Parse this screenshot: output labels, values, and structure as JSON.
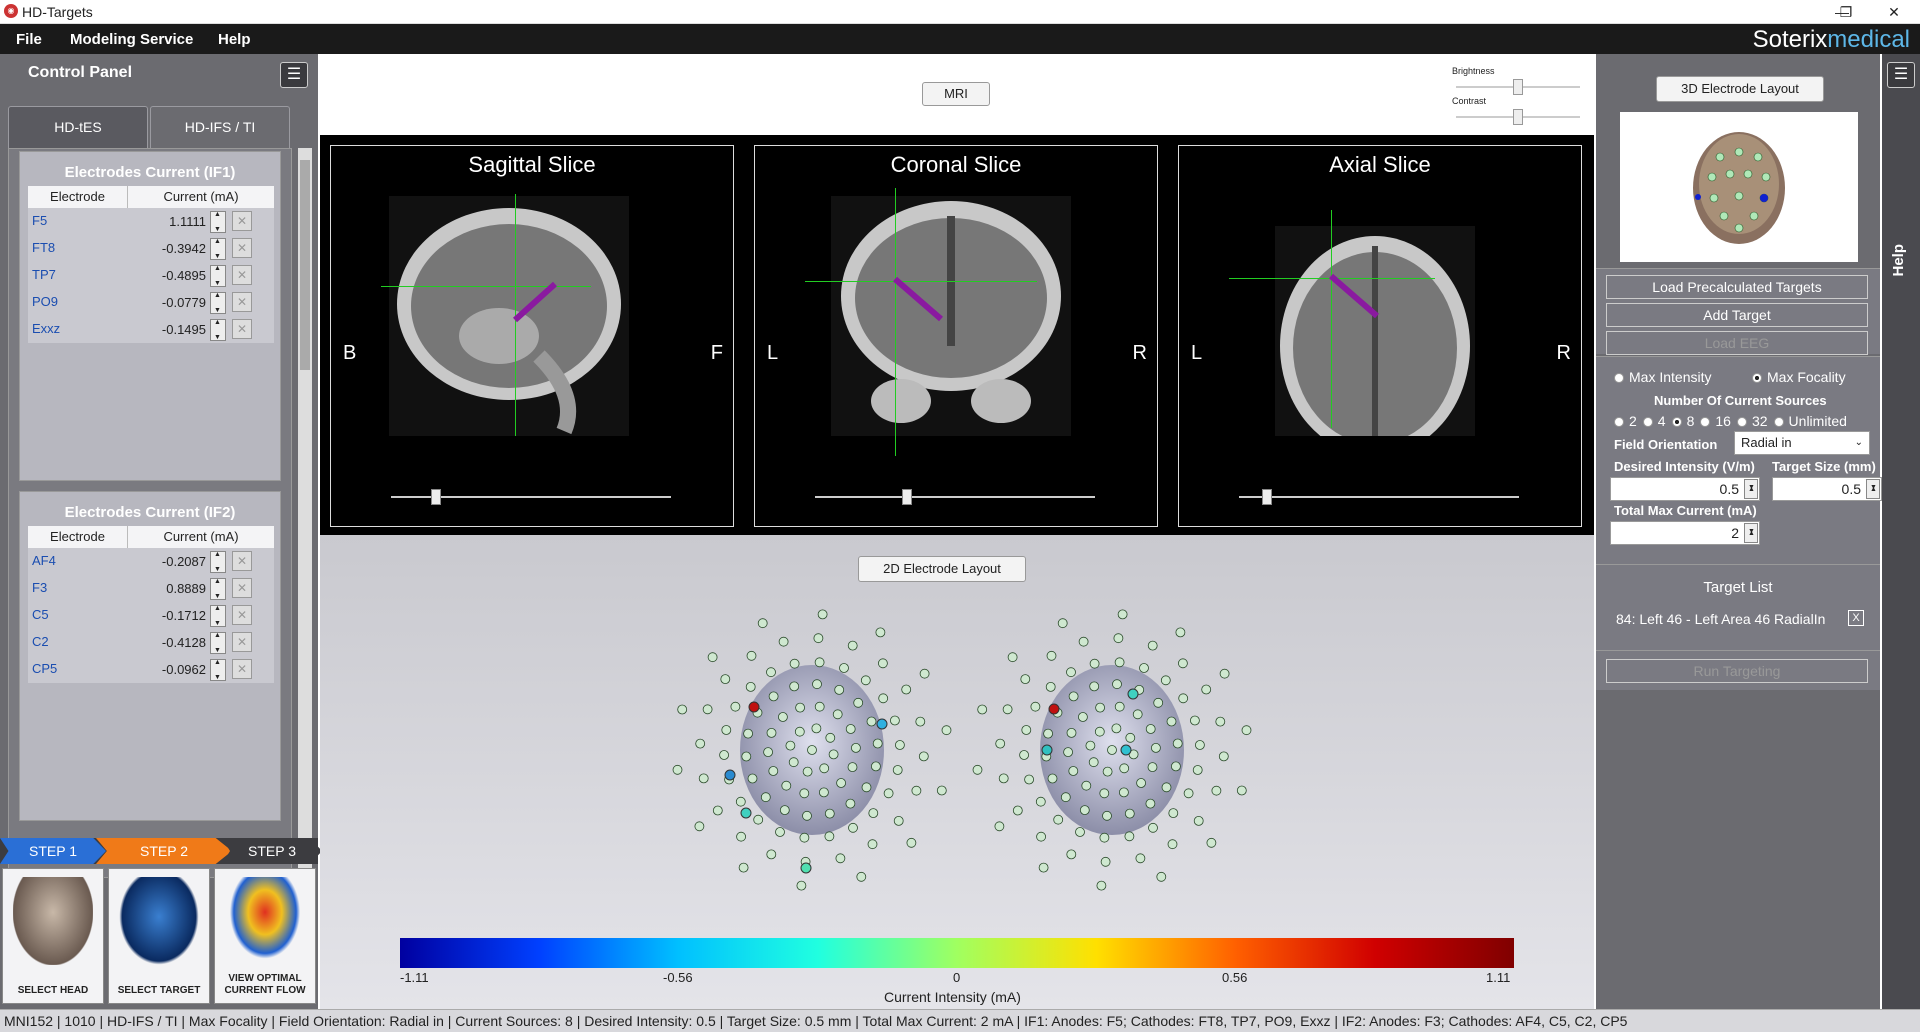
{
  "window": {
    "title": "HD-Targets",
    "minimize": "—",
    "restore": "❐",
    "close": "✕"
  },
  "menu": {
    "file": "File",
    "modeling": "Modeling Service",
    "help": "Help"
  },
  "brand": {
    "part1": "Soterix",
    "part2": "medical"
  },
  "control_panel": {
    "title": "Control Panel",
    "tabs": [
      "HD-tES",
      "HD-IFS / TI"
    ],
    "if1": {
      "title": "Electrodes Current (IF1)",
      "col_electrode": "Electrode",
      "col_current": "Current (mA)",
      "rows": [
        {
          "name": "F5",
          "value": "1.1111"
        },
        {
          "name": "FT8",
          "value": "-0.3942"
        },
        {
          "name": "TP7",
          "value": "-0.4895"
        },
        {
          "name": "PO9",
          "value": "-0.0779"
        },
        {
          "name": "Exxz",
          "value": "-0.1495"
        }
      ]
    },
    "if2": {
      "title": "Electrodes Current (IF2)",
      "col_electrode": "Electrode",
      "col_current": "Current (mA)",
      "rows": [
        {
          "name": "AF4",
          "value": "-0.2087"
        },
        {
          "name": "F3",
          "value": "0.8889"
        },
        {
          "name": "C5",
          "value": "-0.1712"
        },
        {
          "name": "C2",
          "value": "-0.4128"
        },
        {
          "name": "CP5",
          "value": "-0.0962"
        }
      ]
    },
    "steps": [
      "STEP 1",
      "STEP 2",
      "STEP 3"
    ],
    "step_cards": [
      "SELECT HEAD",
      "SELECT TARGET",
      "VIEW OPTIMAL CURRENT FLOW"
    ]
  },
  "viewer": {
    "mri_button": "MRI",
    "brightness": "Brightness",
    "contrast": "Contrast",
    "brightness_level": 0.5,
    "contrast_level": 0.5,
    "slices": [
      {
        "title": "Sagittal Slice",
        "left": "B",
        "right": "F",
        "slider": 0.16
      },
      {
        "title": "Coronal Slice",
        "left": "L",
        "right": "R",
        "slider": 0.33
      },
      {
        "title": "Axial Slice",
        "left": "L",
        "right": "R",
        "slider": 0.1
      }
    ],
    "layout_2d_button": "2D Electrode Layout",
    "colorbar": {
      "ticks": [
        "-1.11",
        "-0.56",
        "0",
        "0.56",
        "1.11"
      ],
      "label": "Current Intensity (mA)"
    }
  },
  "right_panel": {
    "layout_3d_button": "3D Electrode Layout",
    "load_targets": "Load Precalculated Targets",
    "add_target": "Add Target",
    "load_eeg": "Load EEG",
    "max_intensity": "Max Intensity",
    "max_focality": "Max Focality",
    "num_sources_label": "Number Of Current Sources",
    "num_sources": [
      "2",
      "4",
      "8",
      "16",
      "32",
      "Unlimited"
    ],
    "num_sources_selected": "8",
    "field_orientation_label": "Field Orientation",
    "field_orientation_value": "Radial in",
    "desired_intensity_label": "Desired Intensity (V/m)",
    "desired_intensity_value": "0.5",
    "target_size_label": "Target Size (mm)",
    "target_size_value": "0.5",
    "total_max_current_label": "Total Max Current (mA)",
    "total_max_current_value": "2",
    "target_list_title": "Target List",
    "target_item": "84: Left 46 - Left Area 46 RadialIn",
    "target_item_close": "X",
    "run_targeting": "Run Targeting"
  },
  "help_tab": "Help",
  "status": "MNI152 | 1010 | HD-IFS / TI | Max Focality | Field Orientation: Radial in | Current Sources: 8 | Desired Intensity: 0.5 | Target Size: 0.5 mm | Total Max Current: 2 mA |  IF1:  Anodes: F5; Cathodes: FT8, TP7, PO9, Exxz   |  IF2:  Anodes: F3; Cathodes: AF4, C5, C2, CP5"
}
